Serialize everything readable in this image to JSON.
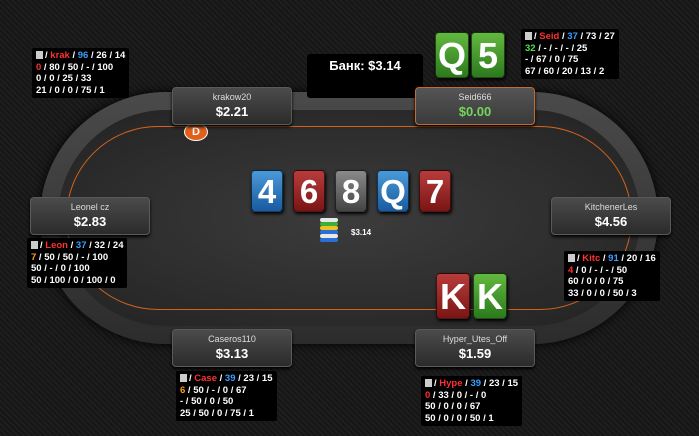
{
  "pot": {
    "label": "Банк: $3.14"
  },
  "dealer_button": "D",
  "board": {
    "cards": [
      {
        "rank": "4",
        "color": "blue"
      },
      {
        "rank": "6",
        "color": "red"
      },
      {
        "rank": "8",
        "color": "gray"
      },
      {
        "rank": "Q",
        "color": "blue"
      },
      {
        "rank": "7",
        "color": "red"
      }
    ],
    "bet_amount": "$3.14"
  },
  "seats": {
    "krakow": {
      "name": "krakow20",
      "stack": "$2.21"
    },
    "seid": {
      "name": "Seid666",
      "stack": "$0.00"
    },
    "leonel": {
      "name": "Leonel cz",
      "stack": "$2.83"
    },
    "kitchener": {
      "name": "KitchenerLes",
      "stack": "$4.56"
    },
    "caseros": {
      "name": "Caseros110",
      "stack": "$3.13"
    },
    "hyper": {
      "name": "Hyper_Utes_Off",
      "stack": "$1.59"
    }
  },
  "hole_cards": {
    "seid": [
      {
        "rank": "Q",
        "color": "green"
      },
      {
        "rank": "5",
        "color": "green"
      }
    ],
    "hyper": [
      {
        "rank": "K",
        "color": "red"
      },
      {
        "rank": "K",
        "color": "green"
      }
    ]
  },
  "huds": {
    "krakow": {
      "nick": "krak",
      "s1": "96",
      "s2": "26",
      "s3": "14",
      "r2a": "0",
      "r2b": "80 / 50 / - / 100",
      "r3": "0 / 0 / 25 / 33",
      "r4": "21 / 0 / 0 / 75 / 1"
    },
    "seid": {
      "nick": "Seid",
      "s1": "37",
      "s2": "73",
      "s3": "27",
      "r2a": "32",
      "r2b": "- / - / - / 25",
      "r3": "- / 67 / 0 / 75",
      "r4": "67 / 60 / 20 / 13 / 2"
    },
    "leonel": {
      "nick": "Leon",
      "s1": "37",
      "s2": "32",
      "s3": "24",
      "r2a": "7",
      "r2b": "50 / 50 / - / 100",
      "r3": "50 / - / 0 / 100",
      "r4": "50 / 100 / 0 / 100 / 0"
    },
    "kitchener": {
      "nick": "Kitc",
      "s1": "91",
      "s2": "20",
      "s3": "16",
      "r2a": "4",
      "r2b": "0 / - / - / 50",
      "r3": "60 / 0 / 0 / 75",
      "r4": "33 / 0 / 0 / 50 / 3"
    },
    "caseros": {
      "nick": "Case",
      "s1": "39",
      "s2": "23",
      "s3": "15",
      "r2a": "6",
      "r2b": "50 / - / 0 / 67",
      "r3": "- / 50 / 0 / 50",
      "r4": "25 / 50 / 0 / 75 / 1"
    },
    "hyper": {
      "nick": "Hype",
      "s1": "39",
      "s2": "23",
      "s3": "15",
      "r2a": "0",
      "r2b": "33 / 0 / - / 0",
      "r3": "50 / 0 / 0 / 67",
      "r4": "50 / 0 / 0 / 50 / 1"
    }
  }
}
